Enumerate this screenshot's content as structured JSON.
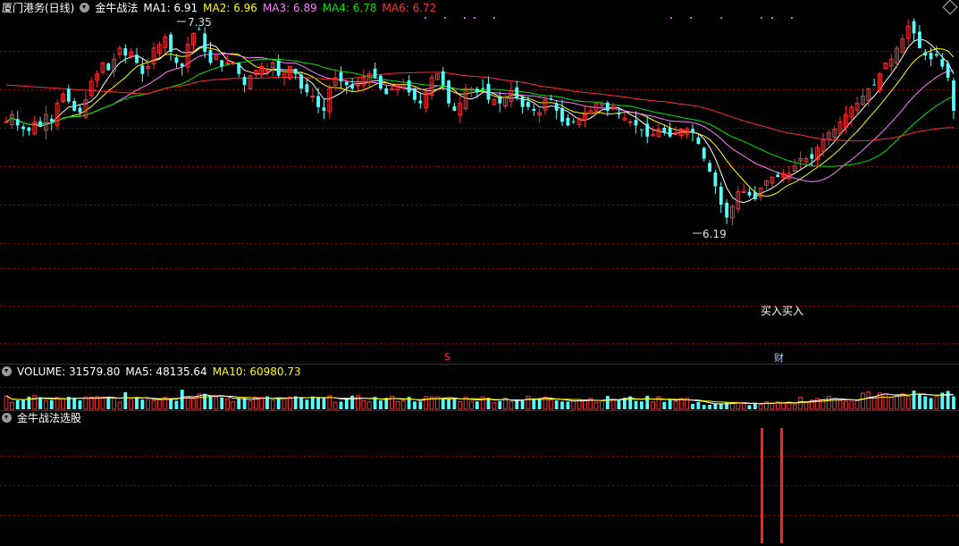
{
  "header": {
    "stock_name": "厦门港务(日线)",
    "indicator_name": "金牛战法",
    "ma": [
      {
        "label": "MA1: 6.91",
        "color": "#ffffff"
      },
      {
        "label": "MA2: 6.96",
        "color": "#ffff00"
      },
      {
        "label": "MA3: 6.89",
        "color": "#ff80ff"
      },
      {
        "label": "MA4: 6.78",
        "color": "#00e600"
      },
      {
        "label": "MA6: 6.72",
        "color": "#ff3030"
      }
    ]
  },
  "volume_header": {
    "volume": "VOLUME: 31579.80",
    "ma5": "MA5: 48135.64",
    "ma10": "MA10: 60980.73"
  },
  "signal_header": {
    "name": "金牛战法选股"
  },
  "annotations": {
    "high_label": "7.35",
    "low_label": "6.19",
    "buy_label": "买入买入",
    "marker_s": "S",
    "marker_cai": "财"
  },
  "colors": {
    "up": "#ff3232",
    "down": "#54ffff",
    "grid": "#8c0000",
    "divider": "#aa0000"
  },
  "chart_data": [
    {
      "type": "candlestick",
      "title": "厦门港务(日线)",
      "ylim": [
        6.19,
        7.35
      ],
      "high": 7.35,
      "low": 6.19,
      "series": [
        {
          "name": "MA1",
          "value": 6.91
        },
        {
          "name": "MA2",
          "value": 6.96
        },
        {
          "name": "MA3",
          "value": 6.89
        },
        {
          "name": "MA4",
          "value": 6.78
        },
        {
          "name": "MA6",
          "value": 6.72
        }
      ],
      "closes": [
        6.8,
        6.84,
        6.78,
        6.76,
        6.75,
        6.8,
        6.78,
        6.84,
        6.8,
        6.9,
        6.95,
        6.91,
        6.86,
        6.85,
        6.92,
        7.02,
        7.06,
        7.12,
        7.08,
        7.14,
        7.2,
        7.16,
        7.18,
        7.12,
        7.06,
        7.1,
        7.2,
        7.22,
        7.26,
        7.18,
        7.12,
        7.1,
        7.22,
        7.28,
        7.3,
        7.18,
        7.12,
        7.16,
        7.1,
        7.12,
        7.12,
        7.06,
        7.0,
        7.05,
        7.08,
        7.1,
        7.08,
        7.12,
        7.05,
        7.06,
        7.1,
        7.06,
        6.98,
        6.96,
        6.94,
        6.88,
        6.86,
        6.98,
        7.04,
        7.02,
        7.0,
        6.98,
        7.0,
        7.04,
        7.06,
        7.04,
        6.98,
        6.95,
        6.98,
        7.0,
        7.0,
        6.96,
        6.92,
        6.9,
        6.96,
        7.04,
        7.06,
        7.0,
        6.9,
        6.86,
        6.9,
        6.98,
        6.98,
        6.96,
        6.98,
        6.92,
        6.92,
        6.9,
        6.93,
        6.97,
        6.93,
        6.88,
        6.88,
        6.86,
        6.85,
        6.92,
        6.92,
        6.86,
        6.8,
        6.78,
        6.8,
        6.82,
        6.84,
        6.86,
        6.9,
        6.9,
        6.86,
        6.88,
        6.84,
        6.82,
        6.8,
        6.78,
        6.76,
        6.72,
        6.73,
        6.76,
        6.74,
        6.72,
        6.74,
        6.76,
        6.76,
        6.74,
        6.68,
        6.6,
        6.53,
        6.45,
        6.35,
        6.28,
        6.34,
        6.42,
        6.42,
        6.4,
        6.38,
        6.44,
        6.48,
        6.5,
        6.5,
        6.52,
        6.52,
        6.56,
        6.6,
        6.6,
        6.6,
        6.66,
        6.7,
        6.74,
        6.76,
        6.8,
        6.84,
        6.88,
        6.9,
        6.94,
        6.98,
        7.0,
        7.06,
        7.12,
        7.14,
        7.2,
        7.25,
        7.32,
        7.28,
        7.2,
        7.16,
        7.14,
        7.16,
        7.1,
        7.04,
        6.86
      ],
      "xlabel": "",
      "ylabel": ""
    },
    {
      "type": "bar",
      "title": "VOLUME",
      "series": [
        {
          "name": "VOLUME",
          "value": 31579.8
        },
        {
          "name": "MA5",
          "value": 48135.64
        },
        {
          "name": "MA10",
          "value": 60980.73
        }
      ]
    },
    {
      "type": "bar",
      "title": "金牛战法选股",
      "signals": [
        {
          "index": 132,
          "value": 1
        },
        {
          "index": 135,
          "value": 1
        }
      ]
    }
  ]
}
